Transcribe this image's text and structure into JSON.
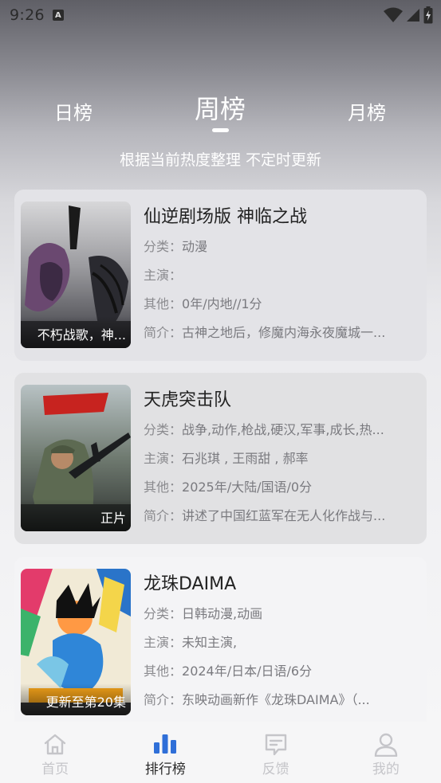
{
  "status_bar": {
    "time": "9:26",
    "notification_letter": "A"
  },
  "tabs": [
    {
      "label": "日榜",
      "active": false
    },
    {
      "label": "周榜",
      "active": true
    },
    {
      "label": "月榜",
      "active": false
    }
  ],
  "subtitle": "根据当前热度整理 不定时更新",
  "items": [
    {
      "title": "仙逆剧场版 神临之战",
      "category_label": "分类：",
      "category": "动漫",
      "cast_label": "主演：",
      "cast": "",
      "other_label": "其他：",
      "other": "0年/内地//1分",
      "intro_label": "简介：",
      "intro": "古神之地后，修魔内海永夜魔城一...",
      "badge": "不朽战歌，神..."
    },
    {
      "title": "天虎突击队",
      "category_label": "分类：",
      "category": "战争,动作,枪战,硬汉,军事,成长,热...",
      "cast_label": "主演：",
      "cast": "石兆琪 , 王雨甜 , 郝率",
      "other_label": "其他：",
      "other": "2025年/大陆/国语/0分",
      "intro_label": "简介：",
      "intro": "讲述了中国红蓝军在无人化作战与...",
      "badge": "正片"
    },
    {
      "title": "龙珠DAIMA",
      "category_label": "分类：",
      "category": "日韩动漫,动画",
      "cast_label": "主演：",
      "cast": "未知主演,",
      "other_label": "其他：",
      "other": "2024年/日本/日语/6分",
      "intro_label": "简介：",
      "intro": "东映动画新作《龙珠DAIMA》（...",
      "badge": "更新至第20集"
    }
  ],
  "bottom_nav": [
    {
      "label": "首页",
      "icon": "home-icon",
      "active": false
    },
    {
      "label": "排行榜",
      "icon": "ranking-bar-icon",
      "active": true
    },
    {
      "label": "反馈",
      "icon": "feedback-icon",
      "active": false
    },
    {
      "label": "我的",
      "icon": "user-icon",
      "active": false
    }
  ],
  "colors": {
    "active_nav_icon": "#2f6fd8",
    "inactive_nav": "#c5c5c9"
  }
}
